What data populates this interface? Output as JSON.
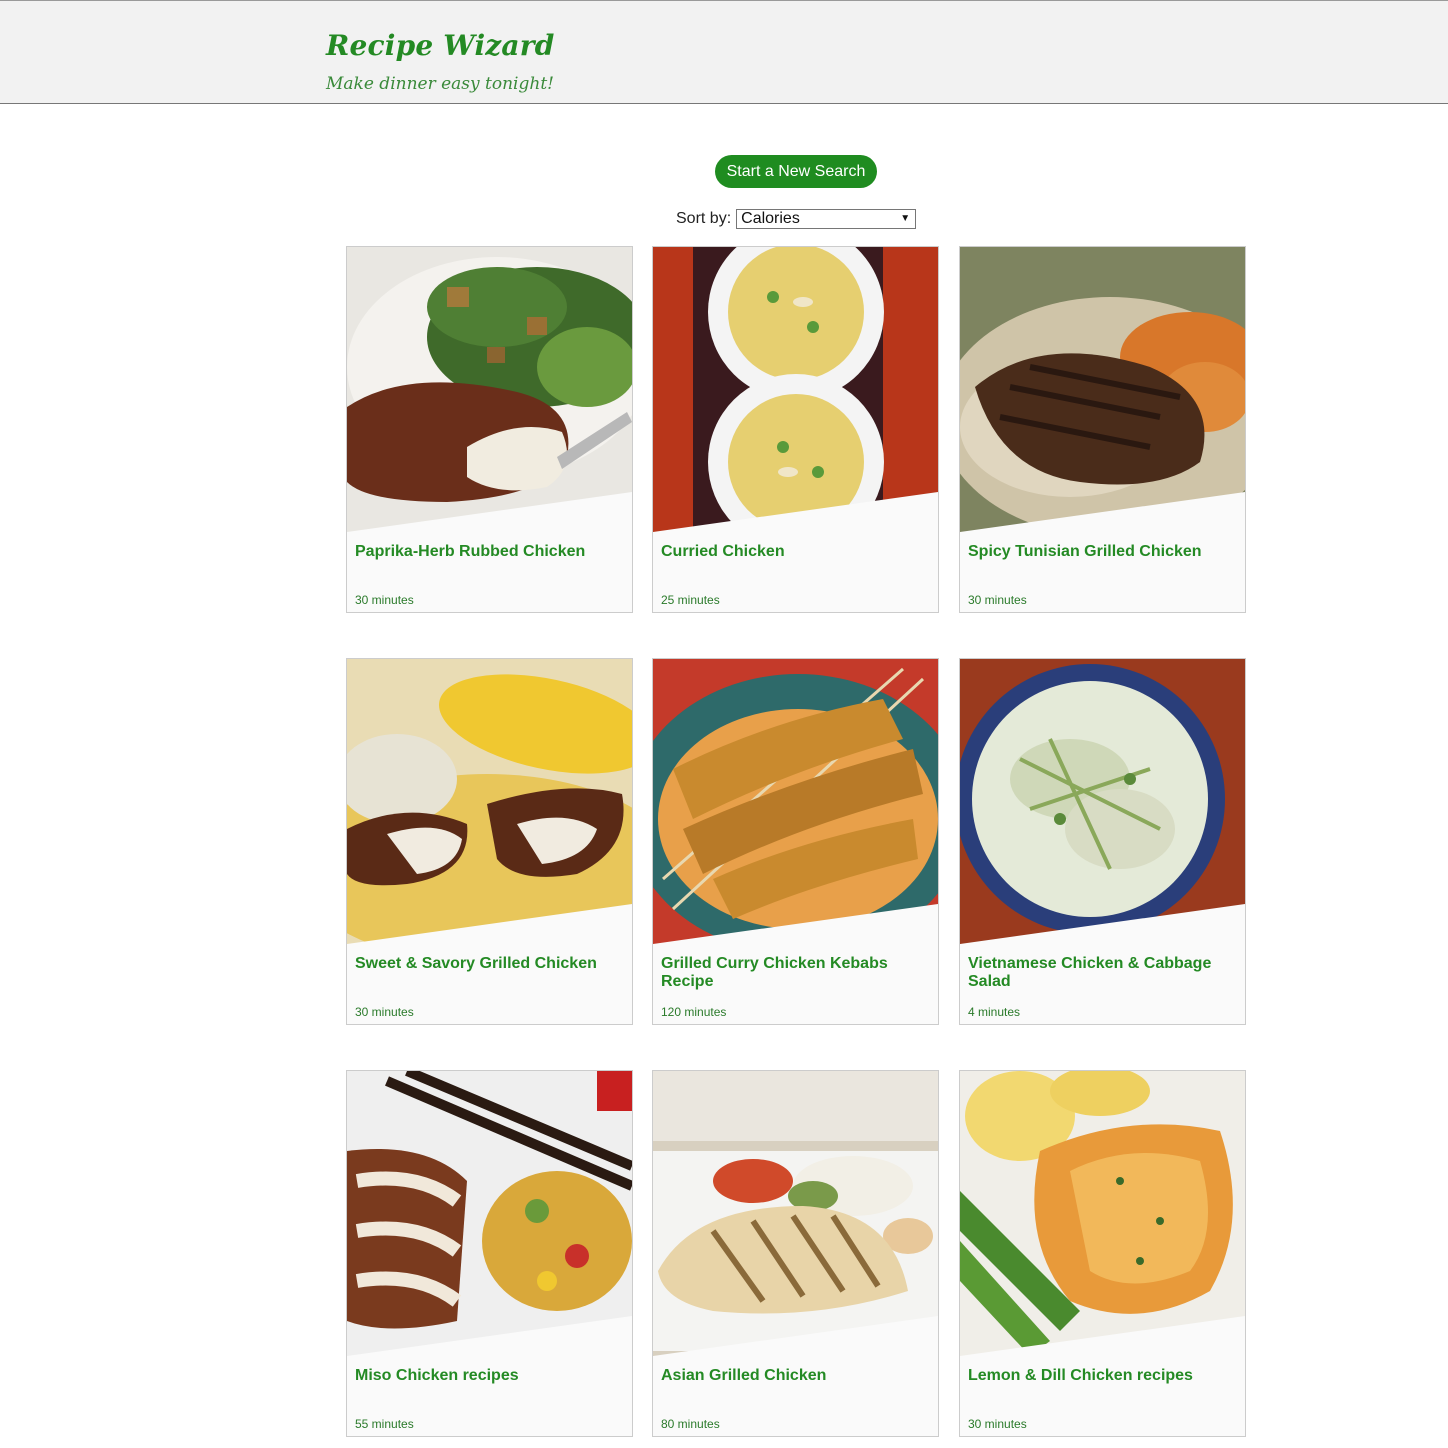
{
  "header": {
    "title": "Recipe Wizard",
    "tagline": "Make dinner easy tonight!"
  },
  "toolbar": {
    "new_search_label": "Start a New Search",
    "sort_label": "Sort by:",
    "sort_value": "Calories"
  },
  "recipes": [
    {
      "title": "Paprika-Herb Rubbed Chicken",
      "time": "30 minutes"
    },
    {
      "title": "Curried Chicken",
      "time": "25 minutes"
    },
    {
      "title": "Spicy Tunisian Grilled Chicken",
      "time": "30 minutes"
    },
    {
      "title": "Sweet & Savory Grilled Chicken",
      "time": "30 minutes"
    },
    {
      "title": "Grilled Curry Chicken Kebabs Recipe",
      "time": "120 minutes"
    },
    {
      "title": "Vietnamese Chicken & Cabbage Salad",
      "time": "4 minutes"
    },
    {
      "title": "Miso Chicken recipes",
      "time": "55 minutes"
    },
    {
      "title": "Asian Grilled Chicken",
      "time": "80 minutes"
    },
    {
      "title": "Lemon & Dill Chicken recipes",
      "time": "30 minutes"
    }
  ],
  "colors": {
    "brand_green": "#248a24",
    "button_green": "#1f8c20",
    "header_bg": "#f2f2f2"
  }
}
